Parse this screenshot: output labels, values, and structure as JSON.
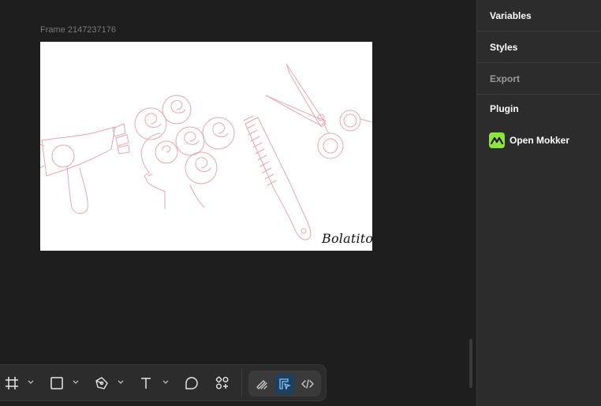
{
  "canvas": {
    "frame_label": "Frame 2147237176",
    "signature": "Bolatito"
  },
  "panel": {
    "variables": "Variables",
    "styles": "Styles",
    "export": "Export",
    "plugin": "Plugin",
    "plugin_item": "Open Mokker"
  },
  "toolbar": {
    "tools": [
      "frame-tool",
      "rectangle-tool",
      "pen-tool",
      "text-tool",
      "comment-tool",
      "actions-tool"
    ],
    "modes": [
      "draw-mode",
      "design-mode",
      "dev-mode"
    ],
    "active_mode": "design-mode"
  },
  "colors": {
    "canvas_bg": "#1e1e1e",
    "panel_bg": "#2c2c2c",
    "illustration_stroke": "#e7a7b1",
    "plugin_accent": "#8fe33f",
    "active_mode": "#1f3f5c"
  }
}
